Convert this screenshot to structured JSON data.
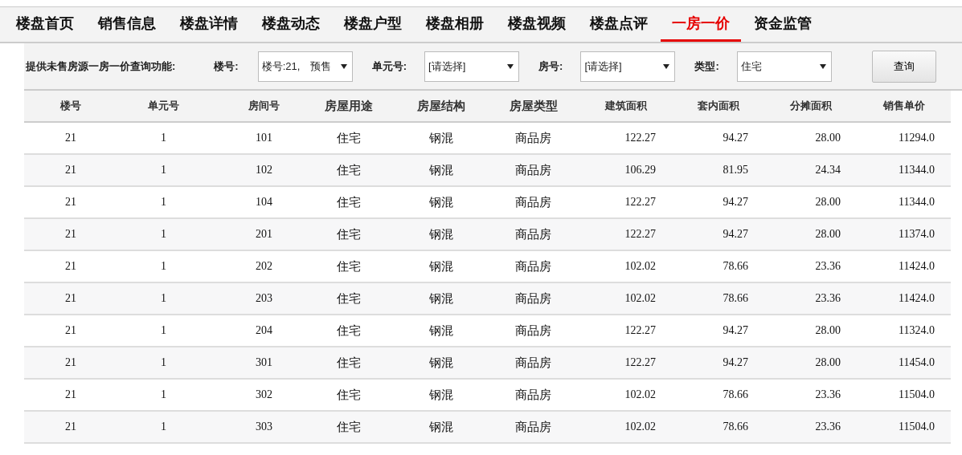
{
  "tabs": [
    {
      "label": "楼盘首页",
      "selected": false
    },
    {
      "label": "销售信息",
      "selected": false
    },
    {
      "label": "楼盘详情",
      "selected": false
    },
    {
      "label": "楼盘动态",
      "selected": false
    },
    {
      "label": "楼盘户型",
      "selected": false
    },
    {
      "label": "楼盘相册",
      "selected": false
    },
    {
      "label": "楼盘视频",
      "selected": false
    },
    {
      "label": "楼盘点评",
      "selected": false
    },
    {
      "label": "一房一价",
      "selected": true
    },
    {
      "label": "资金监管",
      "selected": false
    }
  ],
  "filter": {
    "intro": "提供未售房源一房一价查询功能:",
    "fields": [
      {
        "label": "楼号:",
        "value": "楼号:21,　预售"
      },
      {
        "label": "单元号:",
        "value": "[请选择]"
      },
      {
        "label": "房号:",
        "value": "[请选择]"
      },
      {
        "label": "类型:",
        "value": "住宅"
      }
    ],
    "button": "查询"
  },
  "table": {
    "columns": [
      "楼号",
      "单元号",
      "房间号",
      "房屋用途",
      "房屋结构",
      "房屋类型",
      "建筑面积",
      "套内面积",
      "分摊面积",
      "销售单价"
    ],
    "rows": [
      [
        "21",
        "1",
        "101",
        "住宅",
        "钢混",
        "商品房",
        "122.27",
        "94.27",
        "28.00",
        "11294.0"
      ],
      [
        "21",
        "1",
        "102",
        "住宅",
        "钢混",
        "商品房",
        "106.29",
        "81.95",
        "24.34",
        "11344.0"
      ],
      [
        "21",
        "1",
        "104",
        "住宅",
        "钢混",
        "商品房",
        "122.27",
        "94.27",
        "28.00",
        "11344.0"
      ],
      [
        "21",
        "1",
        "201",
        "住宅",
        "钢混",
        "商品房",
        "122.27",
        "94.27",
        "28.00",
        "11374.0"
      ],
      [
        "21",
        "1",
        "202",
        "住宅",
        "钢混",
        "商品房",
        "102.02",
        "78.66",
        "23.36",
        "11424.0"
      ],
      [
        "21",
        "1",
        "203",
        "住宅",
        "钢混",
        "商品房",
        "102.02",
        "78.66",
        "23.36",
        "11424.0"
      ],
      [
        "21",
        "1",
        "204",
        "住宅",
        "钢混",
        "商品房",
        "122.27",
        "94.27",
        "28.00",
        "11324.0"
      ],
      [
        "21",
        "1",
        "301",
        "住宅",
        "钢混",
        "商品房",
        "122.27",
        "94.27",
        "28.00",
        "11454.0"
      ],
      [
        "21",
        "1",
        "302",
        "住宅",
        "钢混",
        "商品房",
        "102.02",
        "78.66",
        "23.36",
        "11504.0"
      ],
      [
        "21",
        "1",
        "303",
        "住宅",
        "钢混",
        "商品房",
        "102.02",
        "78.66",
        "23.36",
        "11504.0"
      ]
    ]
  }
}
